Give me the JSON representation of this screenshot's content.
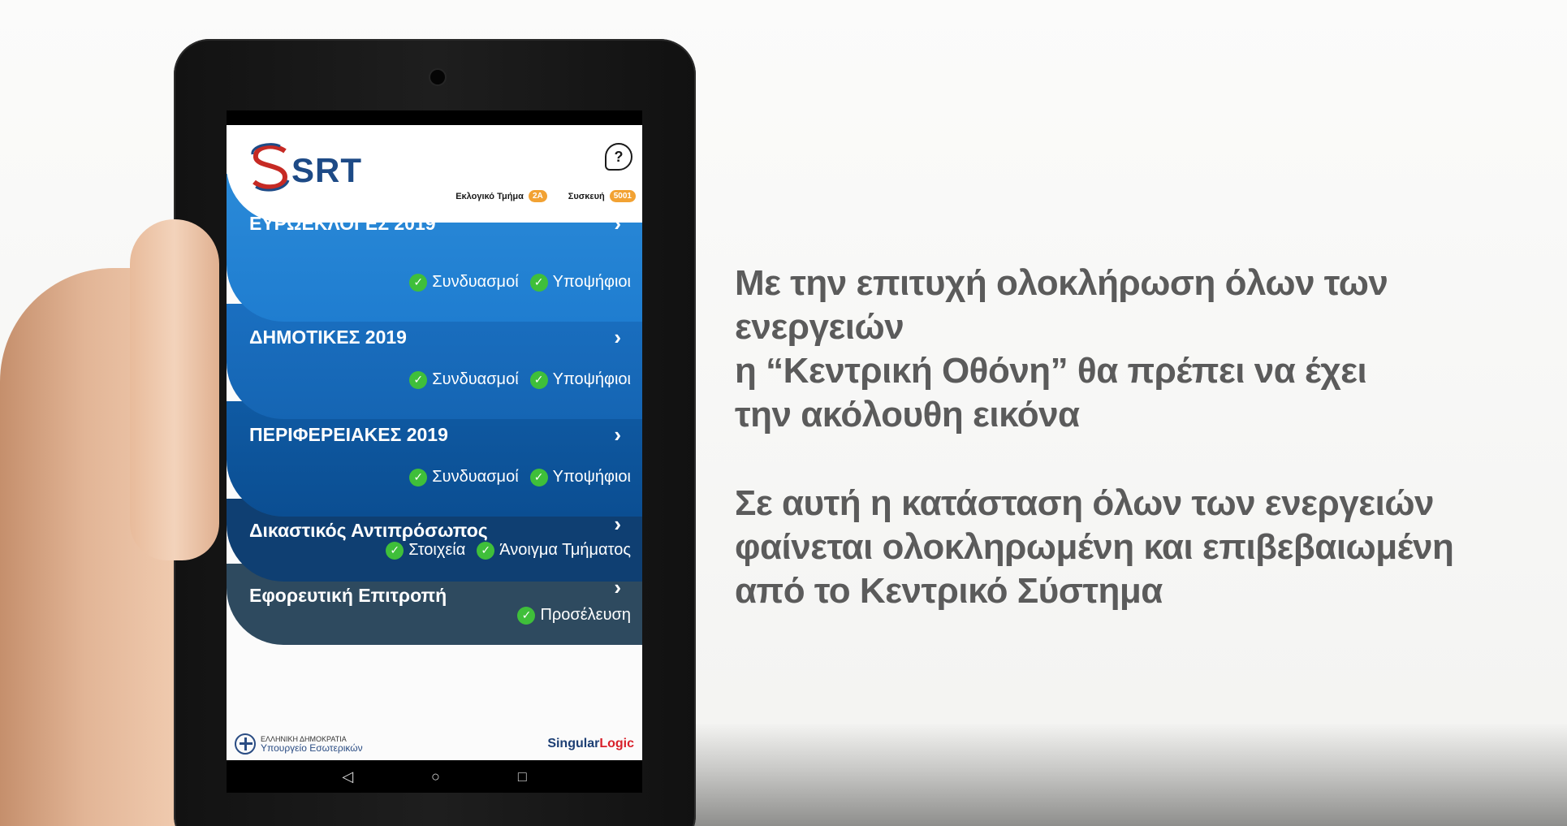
{
  "app": {
    "logo_text": "SRT",
    "meta": {
      "section_label": "Εκλογικό Τμήμα",
      "section_value": "2A",
      "device_label": "Συσκευή",
      "device_value": "5001"
    },
    "cards": [
      {
        "title": "ΕΥΡΩΕΚΛΟΓΕΣ 2019",
        "checks": [
          "Συνδυασμοί",
          "Υποψήφιοι"
        ]
      },
      {
        "title": "ΔΗΜΟΤΙΚΕΣ 2019",
        "checks": [
          "Συνδυασμοί",
          "Υποψήφιοι"
        ]
      },
      {
        "title": "ΠΕΡΙΦΕΡΕΙΑΚΕΣ 2019",
        "checks": [
          "Συνδυασμοί",
          "Υποψήφιοι"
        ]
      },
      {
        "title": "Δικαστικός Αντιπρόσωπος",
        "checks": [
          "Στοιχεία",
          "Άνοιγμα Τμήματος"
        ]
      },
      {
        "title": "Εφορευτική Επιτροπή",
        "checks": [
          "Προσέλευση"
        ]
      }
    ],
    "footer": {
      "gov_line1": "ΕΛΛΗΝΙΚΗ ΔΗΜΟΚΡΑΤΙΑ",
      "gov_line2": "Υπουργείο Εσωτερικών",
      "vendor_a": "Singular",
      "vendor_b": "Logic"
    },
    "nav": {
      "back": "◁",
      "home": "○",
      "recent": "□"
    }
  },
  "caption": {
    "p1": [
      "Με την επιτυχή ολοκλήρωση όλων των ενεργειών",
      "η “Κεντρική Οθόνη” θα πρέπει να έχει",
      "την ακόλουθη εικόνα"
    ],
    "p2": [
      "Σε αυτή η κατάσταση όλων των ενεργειών",
      "φαίνεται ολοκληρωμένη και επιβεβαιωμένη",
      "από το Κεντρικό Σύστημα"
    ]
  },
  "colors": {
    "card1": "#2a8ad8",
    "card2": "#1a6fc0",
    "card3": "#0f5aa3",
    "card4": "#0f3f72",
    "card5": "#2e4a5f",
    "check": "#3fbf3a",
    "badge": "#f2a233",
    "caption": "#5b5b5b"
  },
  "icons": [
    "help-icon",
    "chevron-right-icon",
    "check-circle-icon",
    "back-icon",
    "home-icon",
    "recent-apps-icon"
  ]
}
